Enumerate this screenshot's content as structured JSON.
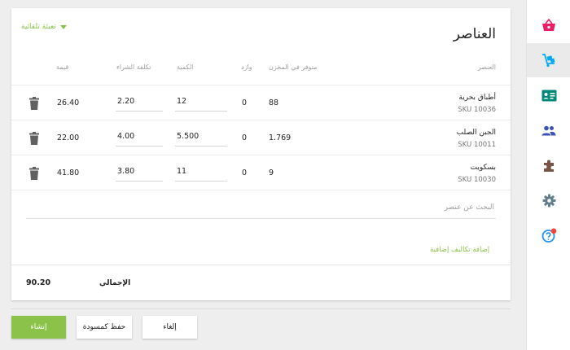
{
  "colors": {
    "accent_green": "#8bc34a",
    "nav_basket": "#e91e63",
    "nav_purchases": "#03a9f4",
    "nav_contacts": "#00897b",
    "nav_team": "#3f51b5",
    "nav_addons": "#795548",
    "nav_settings": "#607d8b",
    "nav_help": "#2196f3",
    "help_badge": "#f44336"
  },
  "nav": {
    "items": [
      {
        "name": "sales",
        "icon": "basket-icon"
      },
      {
        "name": "purchases",
        "icon": "cart-dolly-icon",
        "active": true
      },
      {
        "name": "contacts",
        "icon": "contact-card-icon"
      },
      {
        "name": "team",
        "icon": "people-icon"
      },
      {
        "name": "addons",
        "icon": "puzzle-icon"
      },
      {
        "name": "settings",
        "icon": "gear-icon"
      },
      {
        "name": "help",
        "icon": "help-badge-icon"
      }
    ]
  },
  "items_card": {
    "title": "العناصر",
    "autofill_label": "تعبئة تلقائية",
    "columns": {
      "item": "العنصر",
      "in_stock": "متوفر في المخزن",
      "incoming": "وارد",
      "quantity": "الكمية",
      "purchase_cost": "تكلفة الشراء",
      "value": "قيمة"
    },
    "rows": [
      {
        "name": "أطباق بحرية",
        "sku": "SKU 10036",
        "in_stock": "88",
        "incoming": "0",
        "quantity": "12",
        "purchase_cost": "2.20",
        "value": "26.40",
        "delete_icon": "trash-icon"
      },
      {
        "name": "الجبن الصلب",
        "sku": "SKU 10011",
        "in_stock": "1.769",
        "incoming": "0",
        "quantity": "5.500",
        "purchase_cost": "4.00",
        "value": "22.00",
        "delete_icon": "trash-icon"
      },
      {
        "name": "بسكويت",
        "sku": "SKU 10030",
        "in_stock": "9",
        "incoming": "0",
        "quantity": "11",
        "purchase_cost": "3.80",
        "value": "41.80",
        "delete_icon": "trash-icon"
      }
    ],
    "search_placeholder": "البحث عن عنصر",
    "add_costs_label": "إضافة تكاليف إضافية",
    "total_label": "الإجمالي",
    "total_value": "90.20"
  },
  "actions": {
    "create_label": "إنشاء",
    "save_draft_label": "حفظ كمسودة",
    "cancel_label": "إلغاء"
  }
}
